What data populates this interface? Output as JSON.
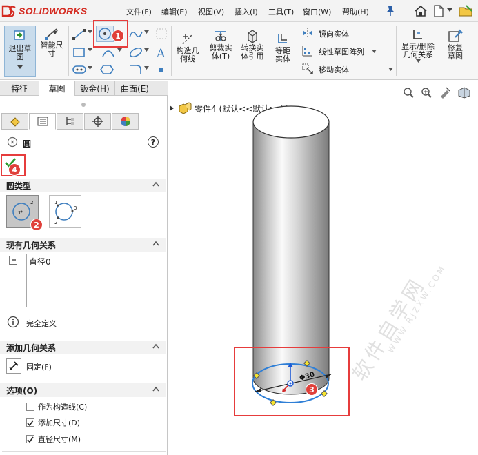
{
  "app": {
    "logo_text": "SOLIDWORKS"
  },
  "menubar": {
    "items": [
      "文件(F)",
      "编辑(E)",
      "视图(V)",
      "插入(I)",
      "工具(T)",
      "窗口(W)",
      "帮助(H)"
    ]
  },
  "ribbon": {
    "exit_sketch": "退出草图",
    "smart_dim": "智能尺寸",
    "construct_geo": "构造几何线",
    "trim": "剪裁实体(T)",
    "convert": "转换实体引用",
    "offset": "等距实体",
    "mirror": "镜向实体",
    "linear_pattern": "线性草图阵列",
    "move": "移动实体",
    "display_delete": "显示/删除几何关系",
    "repair": "修复草图"
  },
  "command_tabs": [
    "特征",
    "草图",
    "钣金(H)",
    "曲面(E)"
  ],
  "panel": {
    "title": "圆",
    "help": "?",
    "circle_type": {
      "header": "圆类型"
    },
    "existing_relations": {
      "header": "现有几何关系",
      "items": [
        "直径0"
      ],
      "status": "完全定义"
    },
    "add_relations": {
      "header": "添加几何关系",
      "fix_label": "固定(F)"
    },
    "options": {
      "header": "选项(O)",
      "items": [
        {
          "label": "作为构造线(C)",
          "checked": false
        },
        {
          "label": "添加尺寸(D)",
          "checked": true
        },
        {
          "label": "直径尺寸(M)",
          "checked": true
        }
      ]
    }
  },
  "viewport": {
    "tree_label": "零件4 (默认<<默认>_显...",
    "dimension_label": "Φ30"
  },
  "watermark": {
    "main": "软件自学网",
    "sub": "WWW.RJZXW.COM"
  },
  "badges": [
    "1",
    "2",
    "3",
    "4"
  ],
  "colors": {
    "accent": "#e63c3c",
    "sketch_blue": "#2f7fd6",
    "logo_red": "#d42a20"
  }
}
